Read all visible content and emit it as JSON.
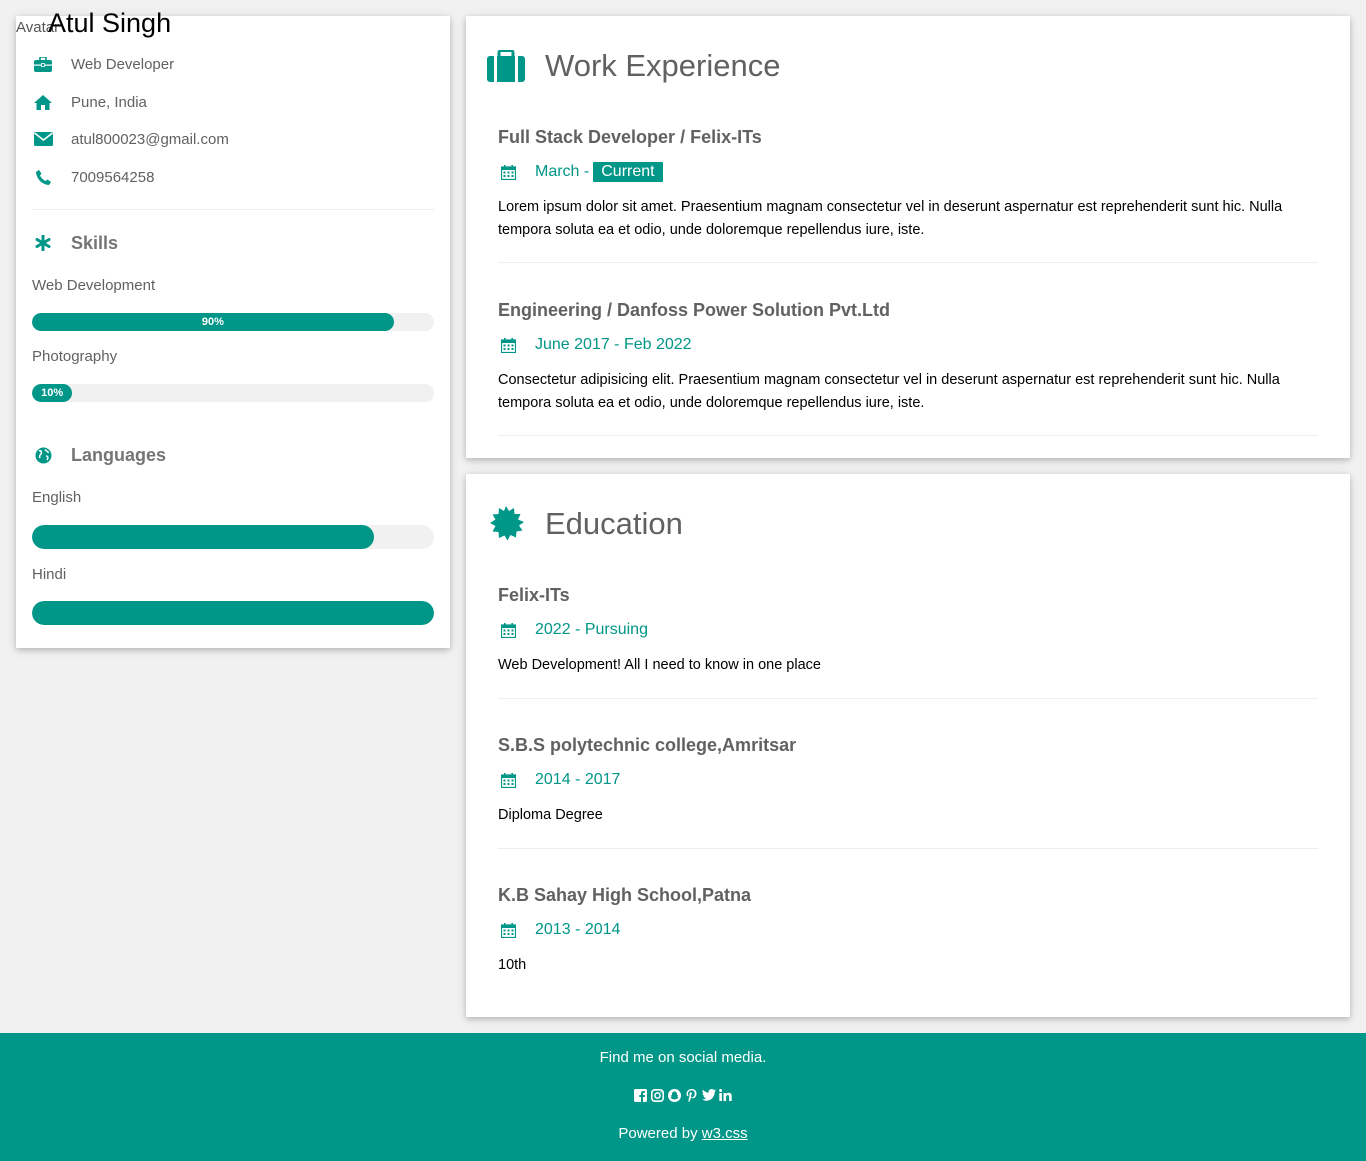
{
  "profile": {
    "name": "Atul Singh",
    "avatar_alt": "Avatar",
    "job": "Web Developer",
    "location": "Pune, India",
    "email": "atul800023@gmail.com",
    "phone": "7009564258"
  },
  "skills": {
    "heading": "Skills",
    "items": [
      {
        "label": "Web Development",
        "percent": 90,
        "display": "90%"
      },
      {
        "label": "Photography",
        "percent": 10,
        "display": "10%"
      }
    ]
  },
  "languages": {
    "heading": "Languages",
    "items": [
      {
        "label": "English",
        "percent": 85
      },
      {
        "label": "Hindi",
        "percent": 100
      }
    ]
  },
  "work": {
    "heading": "Work Experience",
    "entries": [
      {
        "title": "Full Stack Developer / Felix-ITs",
        "date": "March -",
        "tag": "Current",
        "description": "Lorem ipsum dolor sit amet. Praesentium magnam consectetur vel in deserunt aspernatur est reprehenderit sunt hic. Nulla tempora soluta ea et odio, unde doloremque repellendus iure, iste."
      },
      {
        "title": "Engineering / Danfoss Power Solution Pvt.Ltd",
        "date": "June 2017 - Feb 2022",
        "description": "Consectetur adipisicing elit. Praesentium magnam consectetur vel in deserunt aspernatur est reprehenderit sunt hic. Nulla tempora soluta ea et odio, unde doloremque repellendus iure, iste."
      }
    ]
  },
  "education": {
    "heading": "Education",
    "entries": [
      {
        "title": "Felix-ITs",
        "date": "2022 - Pursuing",
        "description": "Web Development! All I need to know in one place"
      },
      {
        "title": "S.B.S polytechnic college,Amritsar",
        "date": "2014 - 2017",
        "description": "Diploma Degree"
      },
      {
        "title": "K.B Sahay High School,Patna",
        "date": "2013 - 2014",
        "description": "10th"
      }
    ]
  },
  "footer": {
    "text": "Find me on social media.",
    "powered_prefix": "Powered by",
    "powered_link": "w3.css",
    "social_icons": [
      "facebook-icon",
      "instagram-icon",
      "snapchat-icon",
      "pinterest-icon",
      "twitter-icon",
      "linkedin-icon"
    ]
  },
  "colors": {
    "accent": "#009688",
    "background": "#f1f1f1",
    "text_muted": "#616161"
  }
}
